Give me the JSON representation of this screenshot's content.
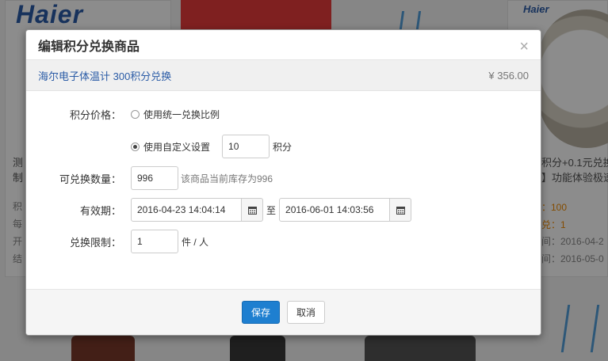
{
  "background": {
    "brand_logo": "Haier",
    "brand_logo_small": "Haier",
    "left_snippets": [
      "测",
      "制",
      "积",
      "每",
      "开",
      "结"
    ],
    "right_title": "积分+0.1元兑换",
    "right_subtitle": "】功能体验极速",
    "right_points": "：100",
    "right_exchange": "兑：1",
    "right_time1": "间：2016-04-2",
    "right_time2": "间：2016-05-0"
  },
  "modal": {
    "title": "编辑积分兑换商品",
    "close_icon": "close-icon",
    "close_symbol": "×"
  },
  "product": {
    "name": "海尔电子体温计 300积分兑换",
    "price": "¥ 356.00"
  },
  "form": {
    "points_price_label": "积分价格：",
    "option_unified": "使用统一兑换比例",
    "option_custom": "使用自定义设置",
    "selected_option": "custom",
    "custom_points_value": "10",
    "points_unit": "积分",
    "quantity_label": "可兑换数量：",
    "quantity_value": "996",
    "quantity_hint": "该商品当前库存为996",
    "validity_label": "有效期：",
    "start_date": "2016-04-23 14:04:14",
    "to_text": "至",
    "end_date": "2016-06-01 14:03:56",
    "calendar_icon": "calendar-icon",
    "limit_label": "兑换限制：",
    "limit_value": "1",
    "limit_unit": "件 / 人"
  },
  "footer": {
    "save_label": "保存",
    "cancel_label": "取消"
  },
  "colors": {
    "primary": "#1e7fd0",
    "product_name": "#2a5ba6",
    "overlay": "rgba(0,0,0,0.45)"
  }
}
